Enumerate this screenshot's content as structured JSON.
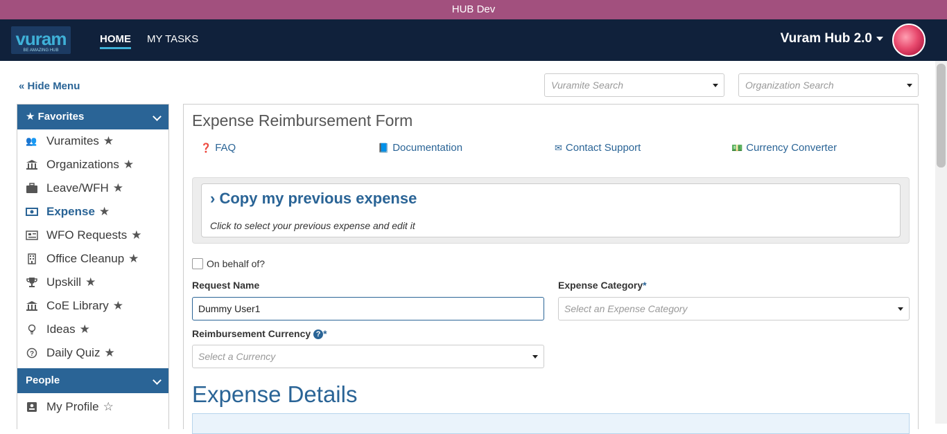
{
  "env": {
    "banner": "HUB Dev"
  },
  "nav": {
    "logo_text": "vuram",
    "logo_sub": "BE AMAZING HUB",
    "home": "HOME",
    "my_tasks": "MY TASKS",
    "app_title": "Vuram Hub 2.0"
  },
  "menu": {
    "hide_label": "Hide Menu"
  },
  "search": {
    "vuramite_placeholder": "Vuramite Search",
    "org_placeholder": "Organization Search"
  },
  "sidebar": {
    "favorites_header": "Favorites",
    "items": [
      {
        "label": "Vuramites",
        "icon": "users-icon"
      },
      {
        "label": "Organizations",
        "icon": "bank-icon"
      },
      {
        "label": "Leave/WFH",
        "icon": "briefcase-icon"
      },
      {
        "label": "Expense",
        "icon": "money-icon"
      },
      {
        "label": "WFO Requests",
        "icon": "newspaper-icon"
      },
      {
        "label": "Office Cleanup",
        "icon": "building-icon"
      },
      {
        "label": "Upskill",
        "icon": "trophy-icon"
      },
      {
        "label": "CoE Library",
        "icon": "bank-icon"
      },
      {
        "label": "Ideas",
        "icon": "lightbulb-icon"
      },
      {
        "label": "Daily Quiz",
        "icon": "question-circle-icon"
      }
    ],
    "people_header": "People",
    "people_items": [
      {
        "label": "My Profile",
        "icon": "id-card-icon"
      }
    ]
  },
  "form": {
    "title": "Expense Reimbursement Form",
    "links": {
      "faq": "FAQ",
      "documentation": "Documentation",
      "contact": "Contact Support",
      "converter": "Currency Converter"
    },
    "copy_title": "Copy my previous expense",
    "copy_sub": "Click to select your previous expense and edit it",
    "on_behalf": "On behalf of?",
    "request_name_label": "Request Name",
    "request_name_value": "Dummy User1",
    "expense_category_label": "Expense Category",
    "expense_category_placeholder": "Select an Expense Category",
    "currency_label": "Reimbursement Currency",
    "currency_placeholder": "Select a Currency",
    "required_mark": "*",
    "details_heading": "Expense Details"
  },
  "colors": {
    "env_bar": "#a2507e",
    "nav_bg": "#10213b",
    "accent": "#2a6496"
  }
}
